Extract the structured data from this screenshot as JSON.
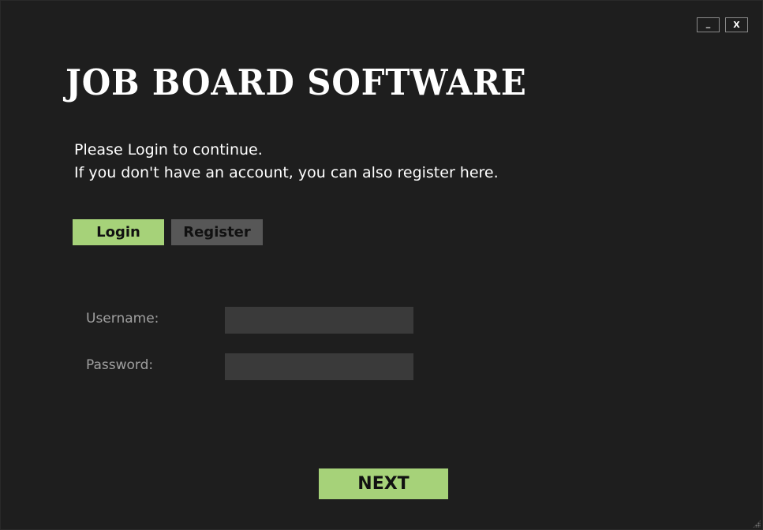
{
  "window": {
    "minimize_label": "_",
    "close_label": "X"
  },
  "app": {
    "title": "JOB BOARD SOFTWARE"
  },
  "intro": {
    "line1": "Please Login to continue.",
    "line2": "If you don't have an account, you can also register here."
  },
  "tabs": {
    "login_label": "Login",
    "register_label": "Register",
    "active": "Login"
  },
  "form": {
    "username_label": "Username:",
    "username_value": "",
    "password_label": "Password:",
    "password_value": ""
  },
  "actions": {
    "next_label": "NEXT"
  },
  "colors": {
    "background": "#1e1e1e",
    "accent": "#a6d279",
    "tab_inactive": "#575757",
    "input_background": "#3a3a3a",
    "label_text": "#a0a0a0"
  }
}
